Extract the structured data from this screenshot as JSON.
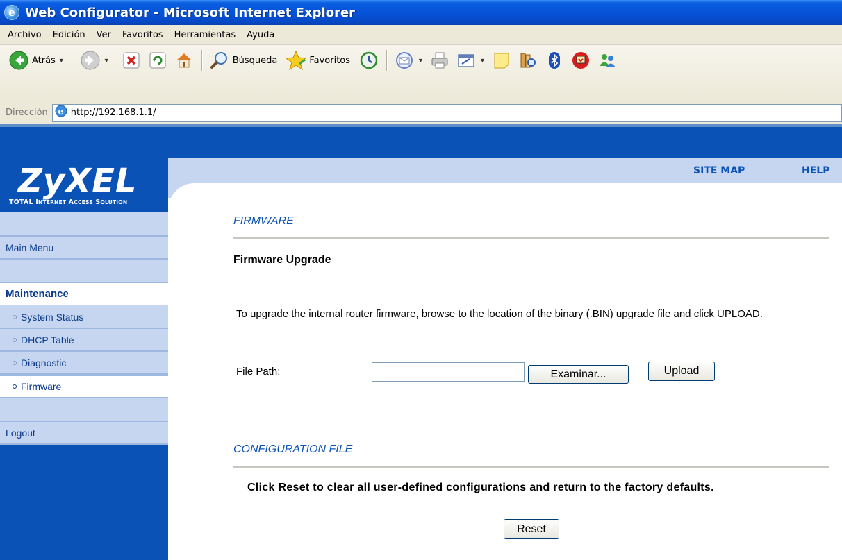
{
  "window": {
    "title": "Web Configurator - Microsoft Internet Explorer"
  },
  "menubar": {
    "items": [
      "Archivo",
      "Edición",
      "Ver",
      "Favoritos",
      "Herramientas",
      "Ayuda"
    ]
  },
  "toolbar": {
    "back_label": "Atrás",
    "search_label": "Búsqueda",
    "favorites_label": "Favoritos"
  },
  "address": {
    "label": "Dirección",
    "url": "http://192.168.1.1/"
  },
  "header": {
    "brand": "ZyXEL",
    "tagline": "Total Internet Access Solution",
    "site_map": "SITE MAP",
    "help": "HELP"
  },
  "sidebar": {
    "main_menu": "Main Menu",
    "section": "Maintenance",
    "items": [
      "System Status",
      "DHCP Table",
      "Diagnostic",
      "Firmware"
    ],
    "active": "Firmware",
    "logout": "Logout"
  },
  "firmware": {
    "title": "FIRMWARE",
    "subtitle": "Firmware Upgrade",
    "description": "To upgrade the internal router firmware, browse to the location of the binary (.BIN) upgrade file and click UPLOAD.",
    "file_path_label": "File Path:",
    "file_path_value": "",
    "browse_label": "Examinar...",
    "upload_label": "Upload"
  },
  "config": {
    "title": "CONFIGURATION FILE",
    "reset_text": "Click Reset to clear all user-defined configurations and return to the factory defaults.",
    "reset_label": "Reset"
  },
  "colors": {
    "brand_blue": "#0a52b5",
    "nav_light": "#c6d6f0",
    "xp_title": "#0653d8"
  }
}
